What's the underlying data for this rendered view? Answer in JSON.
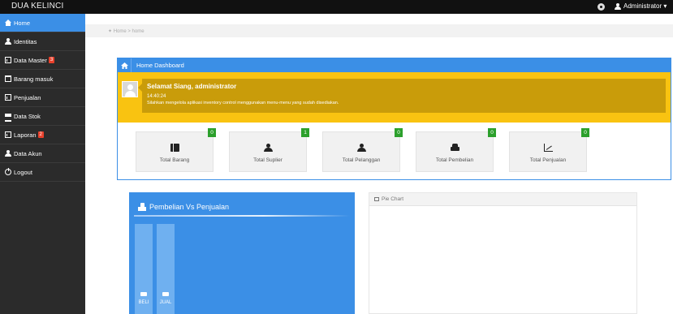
{
  "app": {
    "brand": "DUA KELINCI"
  },
  "topbar": {
    "user_label": "Administrator ▾"
  },
  "sidebar": {
    "items": [
      {
        "label": "Home",
        "icon": "home-icon",
        "active": true
      },
      {
        "label": "Identitas",
        "icon": "user-icon"
      },
      {
        "label": "Data Master",
        "icon": "chart-icon",
        "badge": "3"
      },
      {
        "label": "Barang masuk",
        "icon": "calendar-icon"
      },
      {
        "label": "Penjualan",
        "icon": "chart-icon"
      },
      {
        "label": "Data Stok",
        "icon": "list-icon"
      },
      {
        "label": "Laporan",
        "icon": "chart-icon",
        "badge": "2"
      },
      {
        "label": "Data Akun",
        "icon": "user-icon"
      },
      {
        "label": "Logout",
        "icon": "power-icon"
      }
    ]
  },
  "breadcrumb": {
    "text": "✦ Home > home"
  },
  "dashboard": {
    "title": "Home Dashboard",
    "welcome_title": "Selamat Siang, administrator",
    "time": "14:40:24",
    "message": "Silahkan mengelola aplikasi inventory control menggunakan menu-menu yang sudah disediakan.",
    "stats": [
      {
        "label": "Total Barang",
        "count": "0",
        "icon": "book-icon"
      },
      {
        "label": "Total Suplier",
        "count": "1",
        "icon": "users-icon"
      },
      {
        "label": "Total Pelanggan",
        "count": "0",
        "icon": "users-icon"
      },
      {
        "label": "Total Pembelian",
        "count": "0",
        "icon": "car-icon"
      },
      {
        "label": "Total Penjualan",
        "count": "0",
        "icon": "line-chart-icon"
      }
    ]
  },
  "bar_card": {
    "title": "Pembelian Vs Penjualan",
    "bars": [
      {
        "label": "BELI"
      },
      {
        "label": "JUAL"
      }
    ]
  },
  "pie_panel": {
    "title": "Pie Chart"
  },
  "colors": {
    "primary": "#3b8fe6",
    "warning": "#f9c311",
    "dark": "#2b2b2b",
    "success": "#2ca02c",
    "danger": "#e8412c"
  }
}
